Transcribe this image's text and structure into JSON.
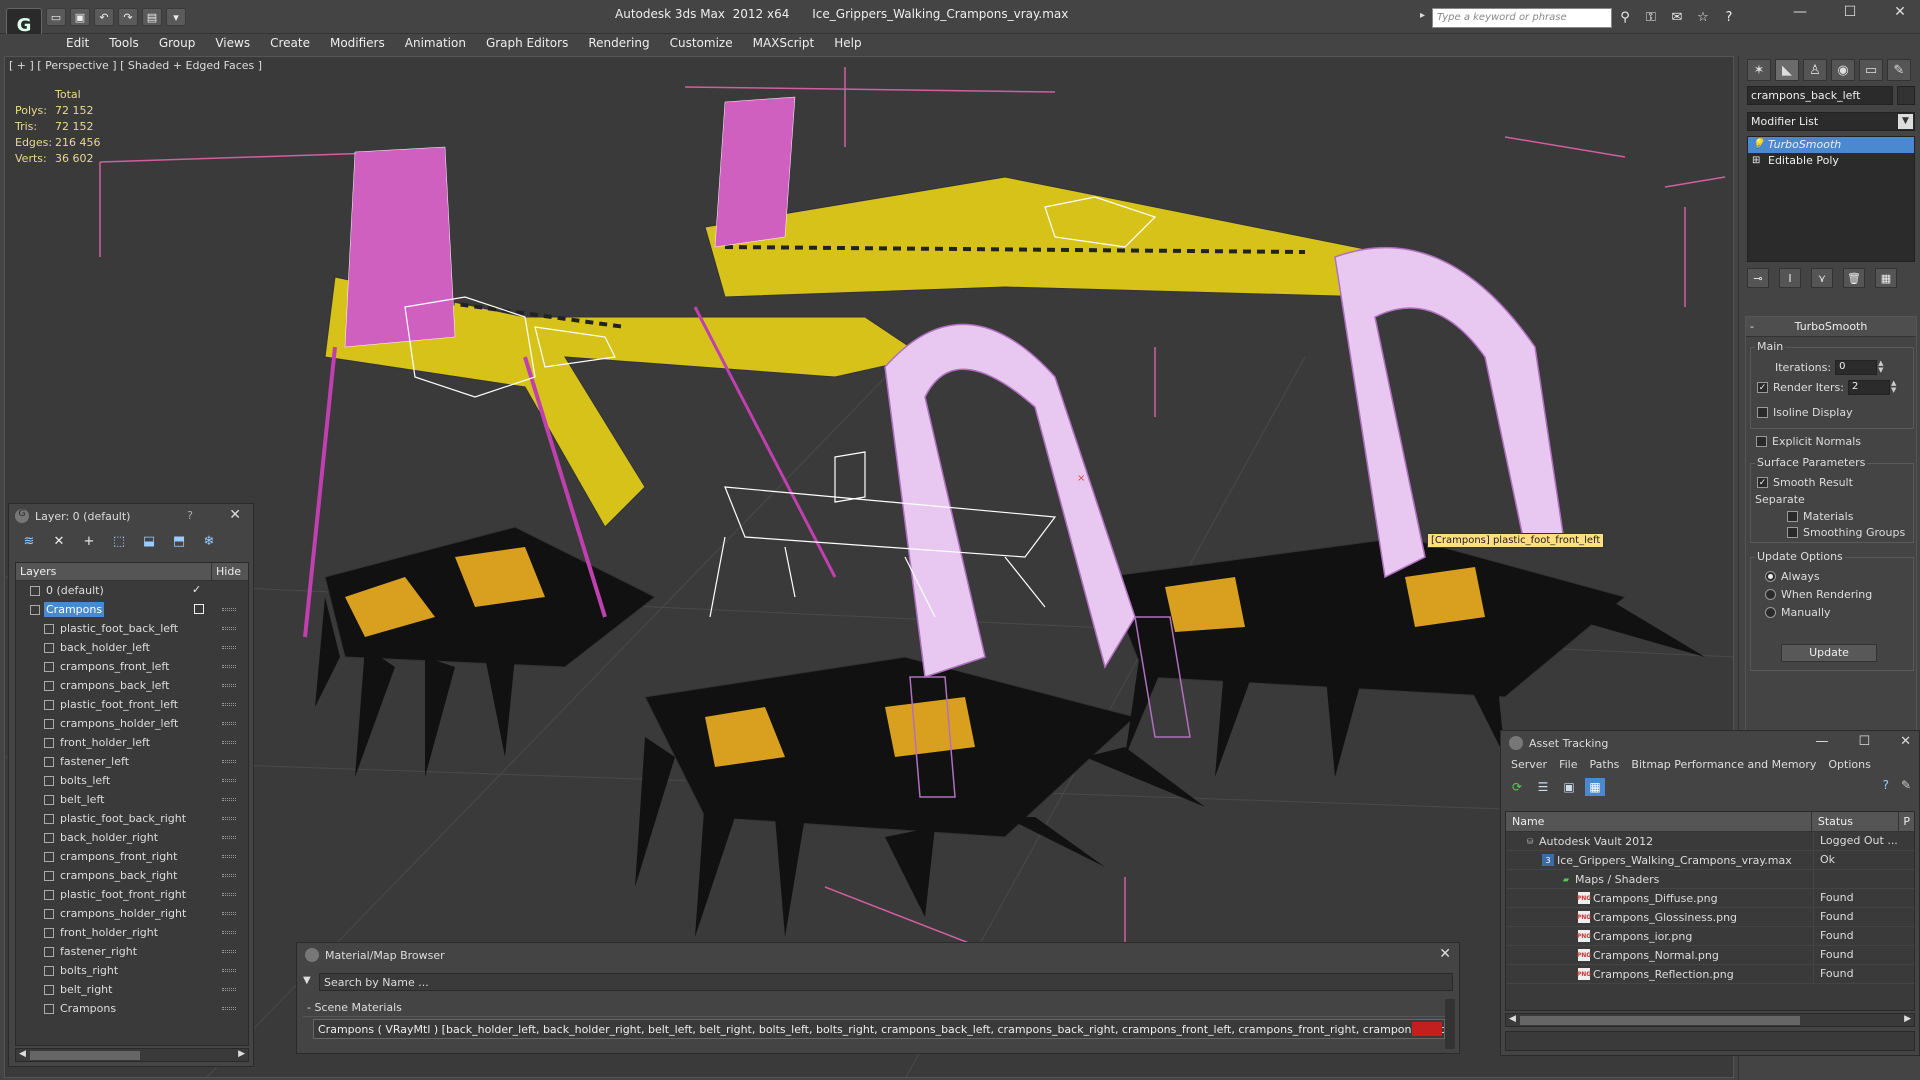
{
  "window": {
    "title": "Autodesk 3ds Max  2012 x64      Ice_Grippers_Walking_Crampons_vray.max",
    "search_placeholder": "Type a keyword or phrase"
  },
  "menu": [
    "Edit",
    "Tools",
    "Group",
    "Views",
    "Create",
    "Modifiers",
    "Animation",
    "Graph Editors",
    "Rendering",
    "Customize",
    "MAXScript",
    "Help"
  ],
  "viewport": {
    "label": "[ + ] [ Perspective ] [ Shaded + Edged Faces ]",
    "stats": {
      "header": "Total",
      "rows": [
        {
          "k": "Polys:",
          "v": "72 152"
        },
        {
          "k": "Tris:",
          "v": "72 152"
        },
        {
          "k": "Edges:",
          "v": "216 456"
        },
        {
          "k": "Verts:",
          "v": "36 602"
        }
      ]
    },
    "tooltip": "[Crampons] plastic_foot_front_left"
  },
  "command_panel": {
    "object_name": "crampons_back_left",
    "modifier_list": "Modifier List",
    "stack": [
      "TurboSmooth",
      "Editable Poly"
    ],
    "turbosmooth": {
      "title": "TurboSmooth",
      "main": "Main",
      "iterations_label": "Iterations:",
      "iterations": "0",
      "render_iters_label": "Render Iters:",
      "render_iters": "2",
      "isoline": "Isoline Display",
      "explicit": "Explicit Normals",
      "surface": "Surface Parameters",
      "smooth_result": "Smooth Result",
      "separate": "Separate",
      "materials": "Materials",
      "smoothing_groups": "Smoothing Groups",
      "update_options": "Update Options",
      "always": "Always",
      "when_rendering": "When Rendering",
      "manually": "Manually",
      "update": "Update"
    }
  },
  "layer_panel": {
    "title": "Layer: 0 (default)",
    "help": "?",
    "col_layers": "Layers",
    "col_hide": "Hide",
    "rows": [
      {
        "name": "0 (default)",
        "level": 1
      },
      {
        "name": "Crampons",
        "level": 1
      },
      {
        "name": "plastic_foot_back_left",
        "level": 2
      },
      {
        "name": "back_holder_left",
        "level": 2
      },
      {
        "name": "crampons_front_left",
        "level": 2
      },
      {
        "name": "crampons_back_left",
        "level": 2
      },
      {
        "name": "plastic_foot_front_left",
        "level": 2
      },
      {
        "name": "crampons_holder_left",
        "level": 2
      },
      {
        "name": "front_holder_left",
        "level": 2
      },
      {
        "name": "fastener_left",
        "level": 2
      },
      {
        "name": "bolts_left",
        "level": 2
      },
      {
        "name": "belt_left",
        "level": 2
      },
      {
        "name": "plastic_foot_back_right",
        "level": 2
      },
      {
        "name": "back_holder_right",
        "level": 2
      },
      {
        "name": "crampons_front_right",
        "level": 2
      },
      {
        "name": "crampons_back_right",
        "level": 2
      },
      {
        "name": "plastic_foot_front_right",
        "level": 2
      },
      {
        "name": "crampons_holder_right",
        "level": 2
      },
      {
        "name": "front_holder_right",
        "level": 2
      },
      {
        "name": "fastener_right",
        "level": 2
      },
      {
        "name": "bolts_right",
        "level": 2
      },
      {
        "name": "belt_right",
        "level": 2
      },
      {
        "name": "Crampons",
        "level": 2
      }
    ]
  },
  "material_browser": {
    "title": "Material/Map Browser",
    "search": "Search by Name ...",
    "section": "- Scene Materials",
    "item": "Crampons  ( VRayMtl ) [back_holder_left, back_holder_right, belt_left, belt_right, bolts_left, bolts_right, crampons_back_left, crampons_back_right, crampons_front_left, crampons_front_right, crampons_holder_left, cram..."
  },
  "asset_tracking": {
    "title": "Asset Tracking",
    "menu": [
      "Server",
      "File",
      "Paths",
      "Bitmap Performance and Memory",
      "Options"
    ],
    "col_name": "Name",
    "col_status": "Status",
    "col_p": "P",
    "rows": [
      {
        "name": "Autodesk Vault 2012",
        "status": "Logged Out ...",
        "icon": "vault",
        "indent": 18
      },
      {
        "name": "Ice_Grippers_Walking_Crampons_vray.max",
        "status": "Ok",
        "icon": "max",
        "indent": 36
      },
      {
        "name": "Maps / Shaders",
        "status": "",
        "icon": "folder",
        "indent": 54
      },
      {
        "name": "Crampons_Diffuse.png",
        "status": "Found",
        "icon": "png",
        "indent": 72
      },
      {
        "name": "Crampons_Glossiness.png",
        "status": "Found",
        "icon": "png",
        "indent": 72
      },
      {
        "name": "Crampons_ior.png",
        "status": "Found",
        "icon": "png",
        "indent": 72
      },
      {
        "name": "Crampons_Normal.png",
        "status": "Found",
        "icon": "png",
        "indent": 72
      },
      {
        "name": "Crampons_Reflection.png",
        "status": "Found",
        "icon": "png",
        "indent": 72
      }
    ]
  }
}
